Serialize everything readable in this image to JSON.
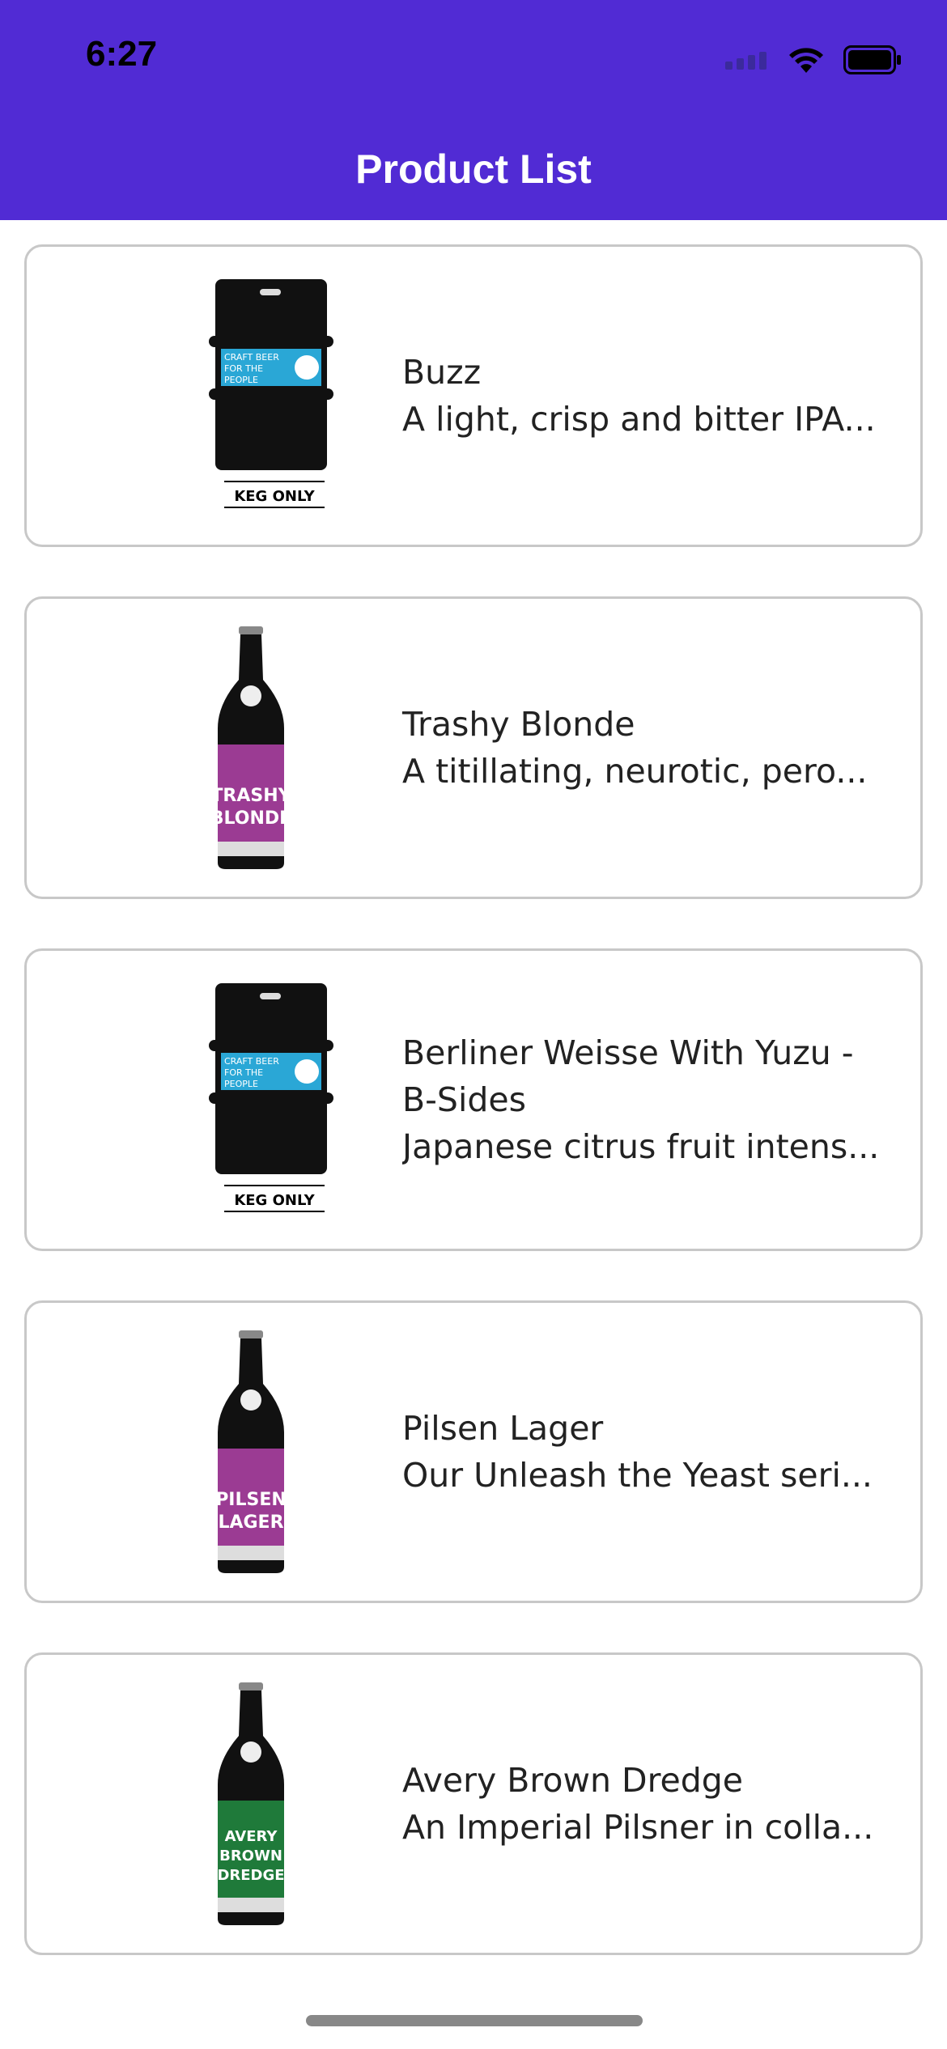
{
  "status": {
    "time": "6:27"
  },
  "header": {
    "title": "Product List",
    "bg": "#512BD4"
  },
  "products": [
    {
      "name": "Buzz",
      "description": "A light, crisp and bitter IPA...",
      "image": "keg",
      "label_color": "#2aa7d6",
      "label_text": "CRAFT BEER FOR THE PEOPLE",
      "footer": "KEG ONLY"
    },
    {
      "name": "Trashy Blonde",
      "description": "A titillating, neurotic, pero...",
      "image": "bottle",
      "label_color": "#9b3b93",
      "label_text": "TRASHY BLONDE"
    },
    {
      "name": "Berliner Weisse With Yuzu - B-Sides",
      "description": "Japanese citrus fruit intens...",
      "image": "keg",
      "label_color": "#2aa7d6",
      "label_text": "CRAFT BEER FOR THE PEOPLE",
      "footer": "KEG ONLY"
    },
    {
      "name": "Pilsen Lager",
      "description": "Our Unleash the Yeast seri...",
      "image": "bottle",
      "label_color": "#9b3b93",
      "label_text": "PILSEN LAGER"
    },
    {
      "name": "Avery Brown Dredge",
      "description": "An Imperial Pilsner in colla...",
      "image": "bottle",
      "label_color": "#1f7a3a",
      "label_text": "AVERY BROWN DREDGE"
    }
  ]
}
